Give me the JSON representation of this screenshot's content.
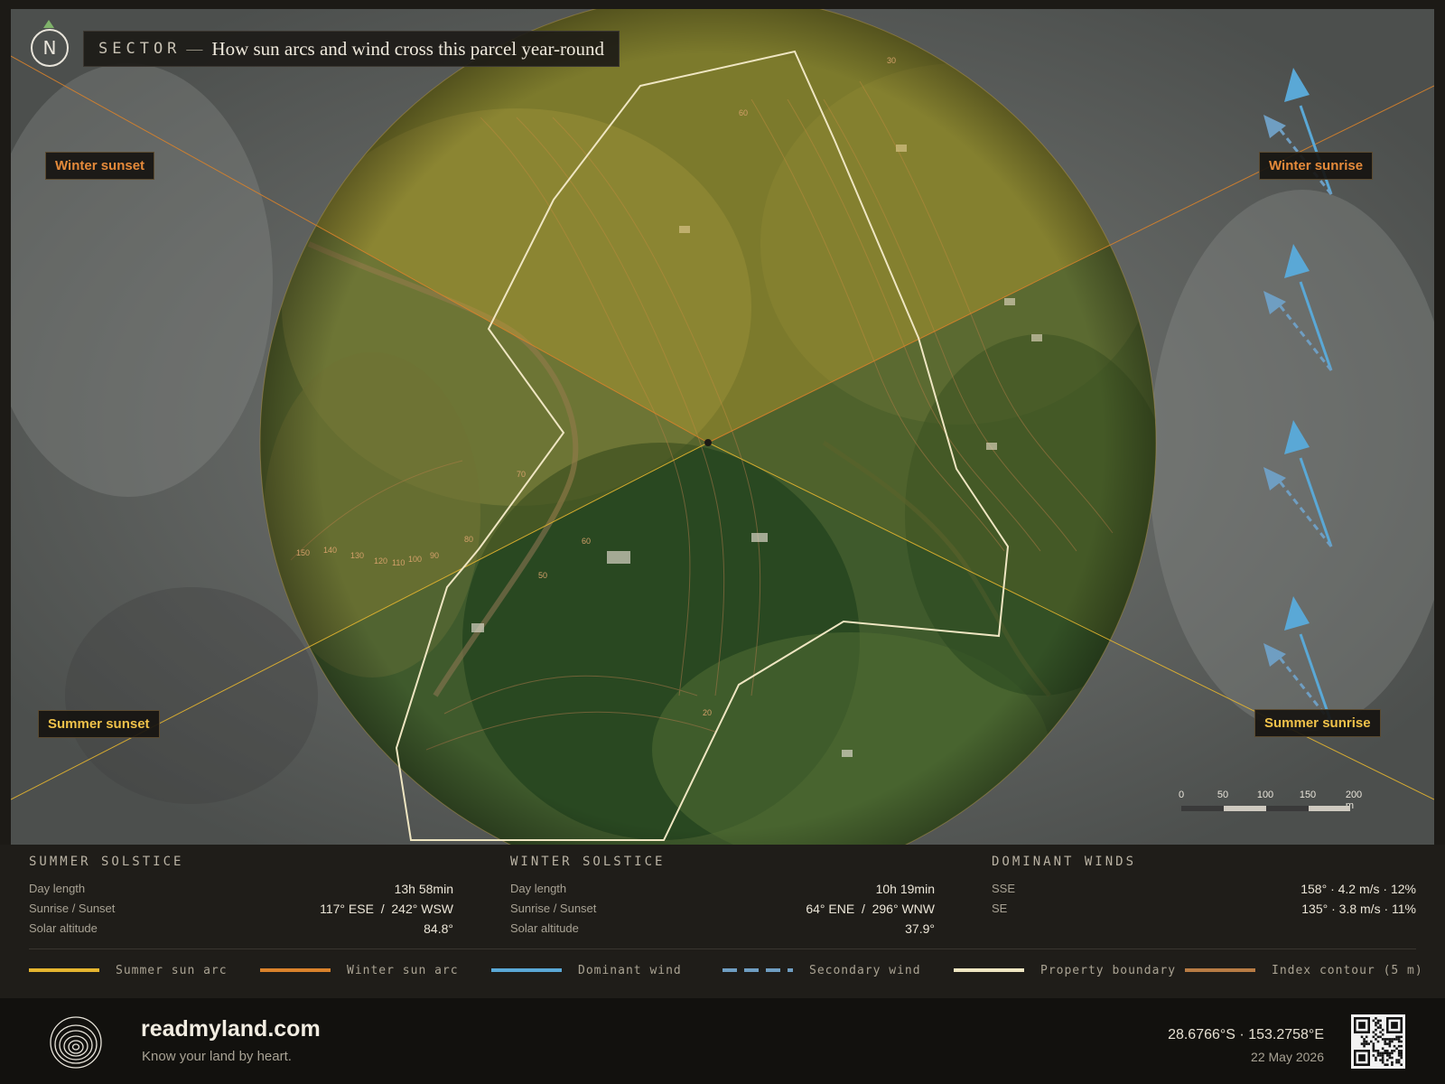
{
  "header": {
    "kicker": "SECTOR",
    "dash": "—",
    "title": "How sun arcs and wind cross this parcel year-round",
    "north": "N"
  },
  "sun_labels": {
    "winter_sunset": "Winter sunset",
    "winter_sunrise": "Winter sunrise",
    "summer_sunset": "Summer sunset",
    "summer_sunrise": "Summer sunrise"
  },
  "contour_labels": [
    "150",
    "140",
    "130",
    "120",
    "110",
    "100",
    "90",
    "80",
    "70",
    "60",
    "20",
    "50",
    "60",
    "30"
  ],
  "scale_bar": {
    "ticks": [
      "0",
      "50",
      "100",
      "150",
      "200 m"
    ]
  },
  "summer": {
    "title": "SUMMER SOLSTICE",
    "rows": [
      {
        "label": "Day length",
        "value": "13h 58min"
      },
      {
        "label": "Sunrise / Sunset",
        "value": "117° ESE  /  242° WSW"
      },
      {
        "label": "Solar altitude",
        "value": "84.8°"
      }
    ]
  },
  "winter": {
    "title": "WINTER SOLSTICE",
    "rows": [
      {
        "label": "Day length",
        "value": "10h 19min"
      },
      {
        "label": "Sunrise / Sunset",
        "value": "64° ENE  /  296° WNW"
      },
      {
        "label": "Solar altitude",
        "value": "37.9°"
      }
    ]
  },
  "winds": {
    "title": "DOMINANT WINDS",
    "rows": [
      {
        "label": "SSE",
        "value": "158° · 4.2 m/s · 12%"
      },
      {
        "label": "SE",
        "value": "135° · 3.8 m/s · 11%"
      }
    ]
  },
  "legend": [
    {
      "label": "Summer sun arc",
      "color": "#e5b52f",
      "style": "solid"
    },
    {
      "label": "Winter sun arc",
      "color": "#d9822b",
      "style": "solid"
    },
    {
      "label": "Dominant wind",
      "color": "#5aa8d6",
      "style": "solid"
    },
    {
      "label": "Secondary wind",
      "color": "#6f9ec2",
      "style": "dashed"
    },
    {
      "label": "Property boundary",
      "color": "#efe6c2",
      "style": "solid"
    },
    {
      "label": "Index contour (5 m)",
      "color": "#b87c44",
      "style": "solid"
    }
  ],
  "footer": {
    "brand": "readmyland.com",
    "tagline": "Know your land by heart.",
    "coords": "28.6766°S · 153.2758°E",
    "date": "22 May 2026"
  },
  "colors": {
    "summer_arc": "#e5b52f",
    "winter_arc": "#d9822b",
    "dominant_wind": "#5aa8d6",
    "secondary_wind": "#6f9ec2",
    "boundary": "#efe6c2"
  }
}
